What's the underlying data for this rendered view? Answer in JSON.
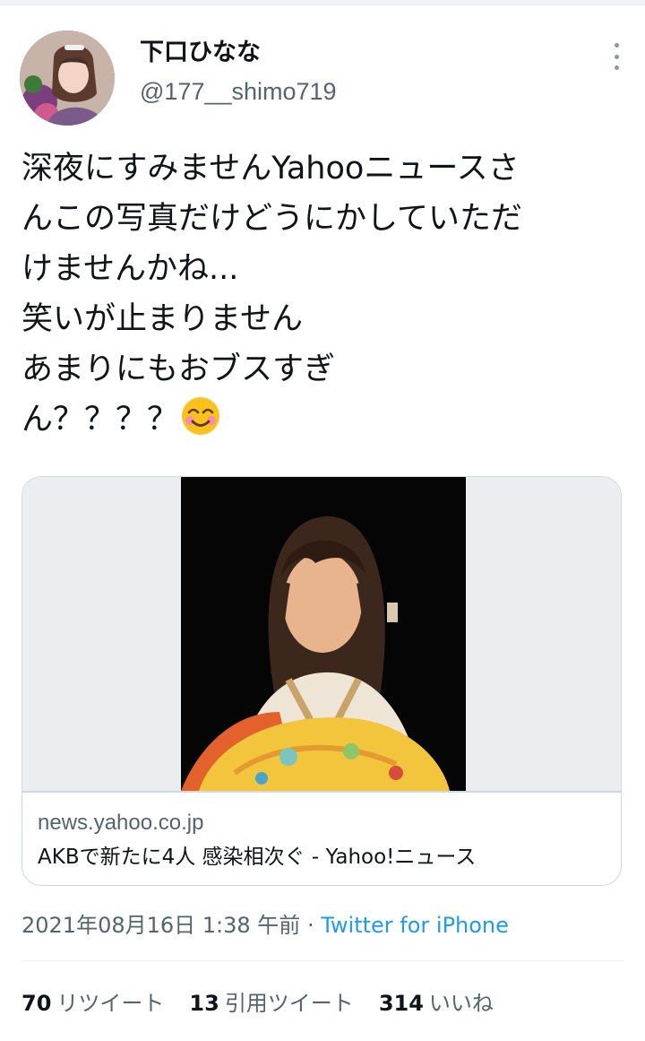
{
  "user": {
    "display_name": "下口ひなな",
    "handle": "@177__shimo719"
  },
  "icons": {
    "more": "more-vertical-icon",
    "emoji": "smiling-face-with-blush-emoji"
  },
  "tweet": {
    "lines": [
      "深夜にすみませんYahooニュースさ",
      "んこの写真だけどうにかしていただ",
      "けませんかね...",
      "笑いが止まりません",
      "あまりにもおブスすぎ",
      "ん？？？？"
    ],
    "emoji": "😊"
  },
  "card": {
    "domain": "news.yahoo.co.jp",
    "title": "AKBで新たに4人 感染相次ぐ - Yahoo!ニュース"
  },
  "meta": {
    "timestamp": "2021年08月16日 1:38 午前",
    "separator": " · ",
    "source": "Twitter for iPhone"
  },
  "stats": [
    {
      "count": "70",
      "label": "リツイート"
    },
    {
      "count": "13",
      "label": "引用ツイート"
    },
    {
      "count": "314",
      "label": "いいね"
    }
  ],
  "colors": {
    "text": "#0f1419",
    "secondary": "#536471",
    "link": "#1d9bf0",
    "border": "#cfd9de"
  }
}
